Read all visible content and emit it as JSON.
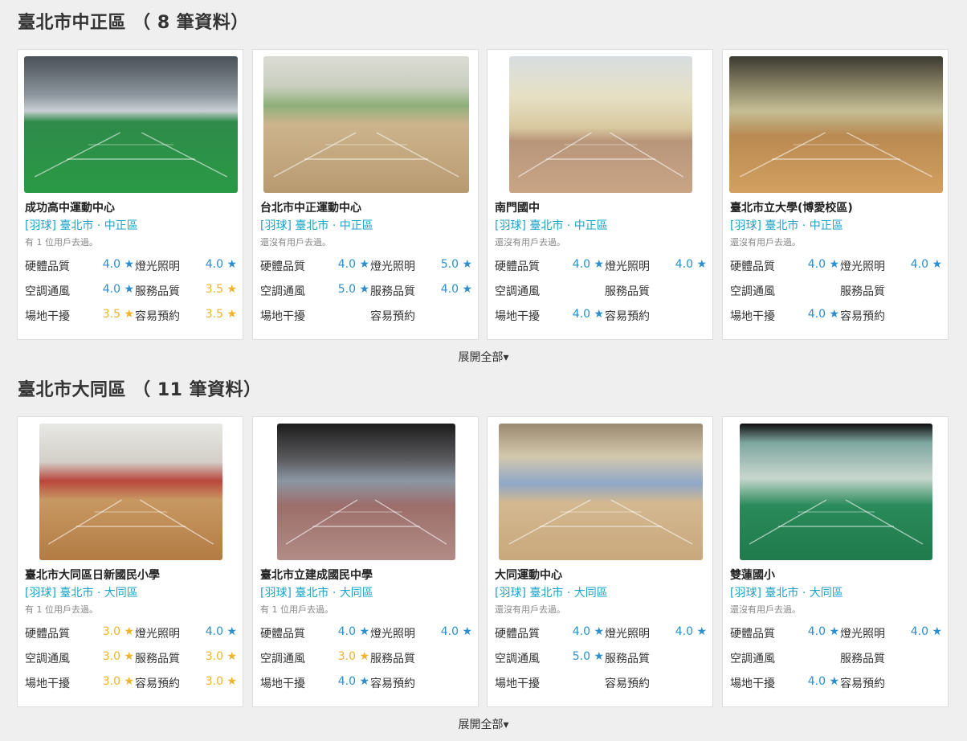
{
  "sections": [
    {
      "title": "臺北市中正區 （ 8 筆資料）",
      "expand_label": "展開全部▾",
      "cards": [
        {
          "name": "成功高中運動中心",
          "tag": "[羽球] 臺北市 · 中正區",
          "visits": "有 1 位用戶去過。",
          "ratings": [
            {
              "l1": "硬體品質",
              "v1": "4.0 ★",
              "c1": "good",
              "l2": "燈光照明",
              "v2": "4.0 ★",
              "c2": "good"
            },
            {
              "l1": "空調通風",
              "v1": "4.0 ★",
              "c1": "good",
              "l2": "服務品質",
              "v2": "3.5 ★",
              "c2": "warn"
            },
            {
              "l1": "場地干擾",
              "v1": "3.5 ★",
              "c1": "warn",
              "l2": "容易預約",
              "v2": "3.5 ★",
              "c2": "warn"
            }
          ]
        },
        {
          "name": "台北市中正運動中心",
          "tag": "[羽球] 臺北市 · 中正區",
          "visits": "還沒有用戶去過。",
          "ratings": [
            {
              "l1": "硬體品質",
              "v1": "4.0 ★",
              "c1": "good",
              "l2": "燈光照明",
              "v2": "5.0 ★",
              "c2": "good"
            },
            {
              "l1": "空調通風",
              "v1": "5.0 ★",
              "c1": "good",
              "l2": "服務品質",
              "v2": "4.0 ★",
              "c2": "good"
            },
            {
              "l1": "場地干擾",
              "v1": "",
              "c1": "good",
              "l2": "容易預約",
              "v2": "",
              "c2": "good"
            }
          ]
        },
        {
          "name": "南門國中",
          "tag": "[羽球] 臺北市 · 中正區",
          "visits": "還沒有用戶去過。",
          "ratings": [
            {
              "l1": "硬體品質",
              "v1": "4.0 ★",
              "c1": "good",
              "l2": "燈光照明",
              "v2": "4.0 ★",
              "c2": "good"
            },
            {
              "l1": "空調通風",
              "v1": "",
              "c1": "good",
              "l2": "服務品質",
              "v2": "",
              "c2": "good"
            },
            {
              "l1": "場地干擾",
              "v1": "4.0 ★",
              "c1": "good",
              "l2": "容易預約",
              "v2": "",
              "c2": "good"
            }
          ]
        },
        {
          "name": "臺北市立大學(博愛校區)",
          "tag": "[羽球] 臺北市 · 中正區",
          "visits": "還沒有用戶去過。",
          "ratings": [
            {
              "l1": "硬體品質",
              "v1": "4.0 ★",
              "c1": "good",
              "l2": "燈光照明",
              "v2": "4.0 ★",
              "c2": "good"
            },
            {
              "l1": "空調通風",
              "v1": "",
              "c1": "good",
              "l2": "服務品質",
              "v2": "",
              "c2": "good"
            },
            {
              "l1": "場地干擾",
              "v1": "4.0 ★",
              "c1": "good",
              "l2": "容易預約",
              "v2": "",
              "c2": "good"
            }
          ]
        }
      ]
    },
    {
      "title": "臺北市大同區 （ 11 筆資料）",
      "expand_label": "展開全部▾",
      "cards": [
        {
          "name": "臺北市大同區日新國民小學",
          "tag": "[羽球] 臺北市 · 大同區",
          "visits": "有 1 位用戶去過。",
          "ratings": [
            {
              "l1": "硬體品質",
              "v1": "3.0 ★",
              "c1": "warn",
              "l2": "燈光照明",
              "v2": "4.0 ★",
              "c2": "good"
            },
            {
              "l1": "空調通風",
              "v1": "3.0 ★",
              "c1": "warn",
              "l2": "服務品質",
              "v2": "3.0 ★",
              "c2": "warn"
            },
            {
              "l1": "場地干擾",
              "v1": "3.0 ★",
              "c1": "warn",
              "l2": "容易預約",
              "v2": "3.0 ★",
              "c2": "warn"
            }
          ]
        },
        {
          "name": "臺北市立建成國民中學",
          "tag": "[羽球] 臺北市 · 大同區",
          "visits": "有 1 位用戶去過。",
          "ratings": [
            {
              "l1": "硬體品質",
              "v1": "4.0 ★",
              "c1": "good",
              "l2": "燈光照明",
              "v2": "4.0 ★",
              "c2": "good"
            },
            {
              "l1": "空調通風",
              "v1": "3.0 ★",
              "c1": "warn",
              "l2": "服務品質",
              "v2": "",
              "c2": "good"
            },
            {
              "l1": "場地干擾",
              "v1": "4.0 ★",
              "c1": "good",
              "l2": "容易預約",
              "v2": "",
              "c2": "good"
            }
          ]
        },
        {
          "name": "大同運動中心",
          "tag": "[羽球] 臺北市 · 大同區",
          "visits": "還沒有用戶去過。",
          "ratings": [
            {
              "l1": "硬體品質",
              "v1": "4.0 ★",
              "c1": "good",
              "l2": "燈光照明",
              "v2": "4.0 ★",
              "c2": "good"
            },
            {
              "l1": "空調通風",
              "v1": "5.0 ★",
              "c1": "good",
              "l2": "服務品質",
              "v2": "",
              "c2": "good"
            },
            {
              "l1": "場地干擾",
              "v1": "",
              "c1": "good",
              "l2": "容易預約",
              "v2": "",
              "c2": "good"
            }
          ]
        },
        {
          "name": "雙蓮國小",
          "tag": "[羽球] 臺北市 · 大同區",
          "visits": "還沒有用戶去過。",
          "ratings": [
            {
              "l1": "硬體品質",
              "v1": "4.0 ★",
              "c1": "good",
              "l2": "燈光照明",
              "v2": "4.0 ★",
              "c2": "good"
            },
            {
              "l1": "空調通風",
              "v1": "",
              "c1": "good",
              "l2": "服務品質",
              "v2": "",
              "c2": "good"
            },
            {
              "l1": "場地干擾",
              "v1": "4.0 ★",
              "c1": "good",
              "l2": "容易預約",
              "v2": "",
              "c2": "good"
            }
          ]
        }
      ]
    }
  ]
}
